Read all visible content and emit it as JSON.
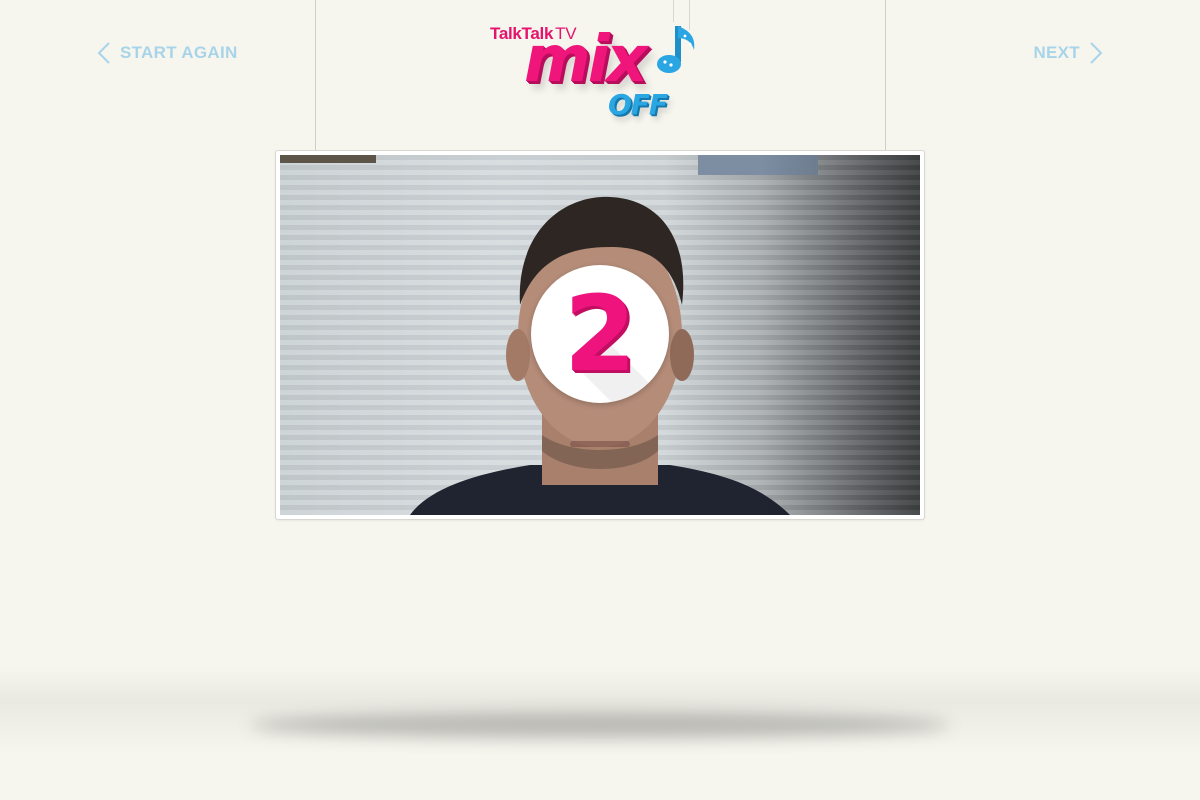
{
  "nav": {
    "back_label": "START AGAIN",
    "next_label": "NEXT"
  },
  "logo": {
    "brand": "TalkTalk",
    "brand_suffix": "TV",
    "title_top": "mix",
    "title_bottom": "OFF"
  },
  "countdown": {
    "value": "2"
  },
  "colors": {
    "background": "#f6f5ee",
    "nav_text": "#a8d4ea",
    "brand_pink": "#f0157a",
    "brand_blue": "#2aa6e3"
  },
  "icons": {
    "back": "chevron-left-icon",
    "next": "chevron-right-icon",
    "note": "music-note-icon"
  }
}
